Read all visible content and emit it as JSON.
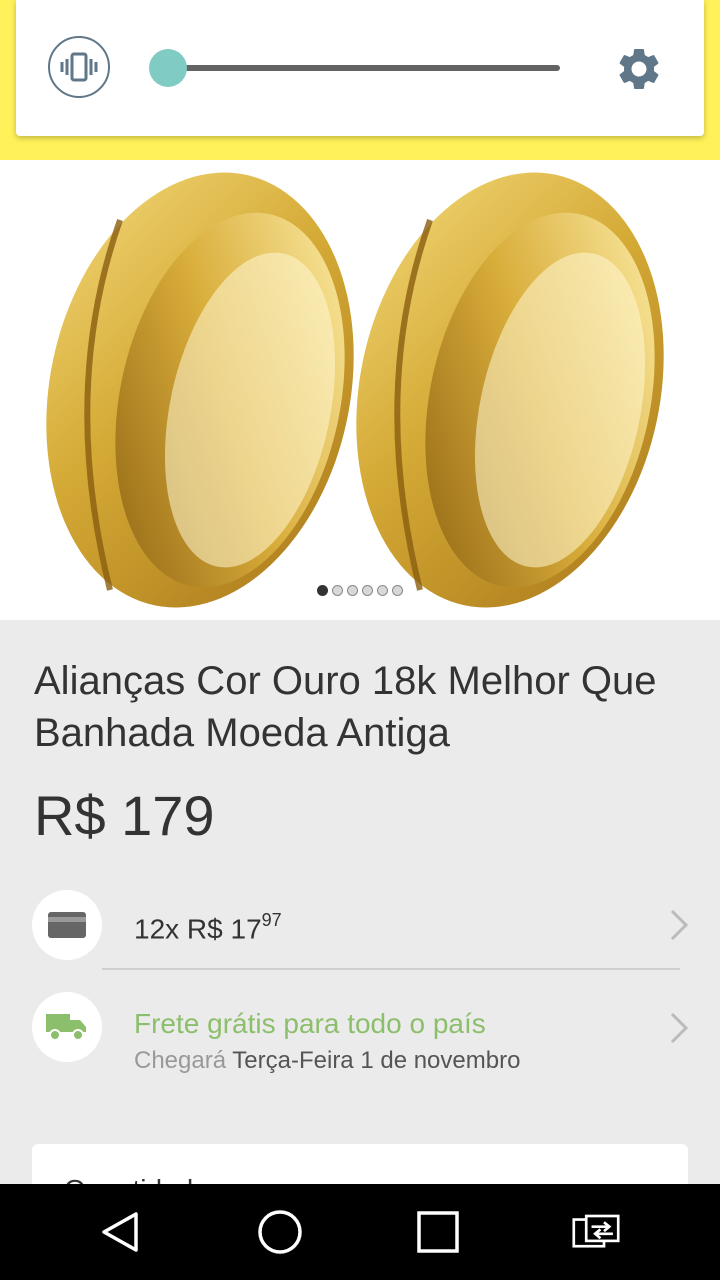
{
  "volume_panel": {
    "level": 0.03,
    "vibrate_icon": "vibrate-icon",
    "settings_icon": "gear-icon"
  },
  "carousel": {
    "total": 6,
    "active_index": 0
  },
  "product": {
    "title": "Alianças Cor Ouro 18k Melhor Que Banhada Moeda Antiga",
    "price": "R$ 179"
  },
  "installments": {
    "prefix": "12x R$ 17",
    "cents": "97",
    "icon": "credit-card-icon"
  },
  "shipping": {
    "title": "Frete grátis para todo o país",
    "arrives_label": "Chegará",
    "arrives_date": "Terça-Feira 1 de novembro",
    "icon": "truck-icon"
  },
  "quantity": {
    "label": "Quantidade"
  },
  "nav_bar": {
    "back_icon": "back-icon",
    "home_icon": "home-icon",
    "recents_icon": "recents-icon",
    "switch_icon": "switch-app-icon"
  },
  "colors": {
    "header_yellow": "#fff159",
    "slider_accent": "#80cbc4",
    "shipping_green": "#8cbf6c"
  }
}
